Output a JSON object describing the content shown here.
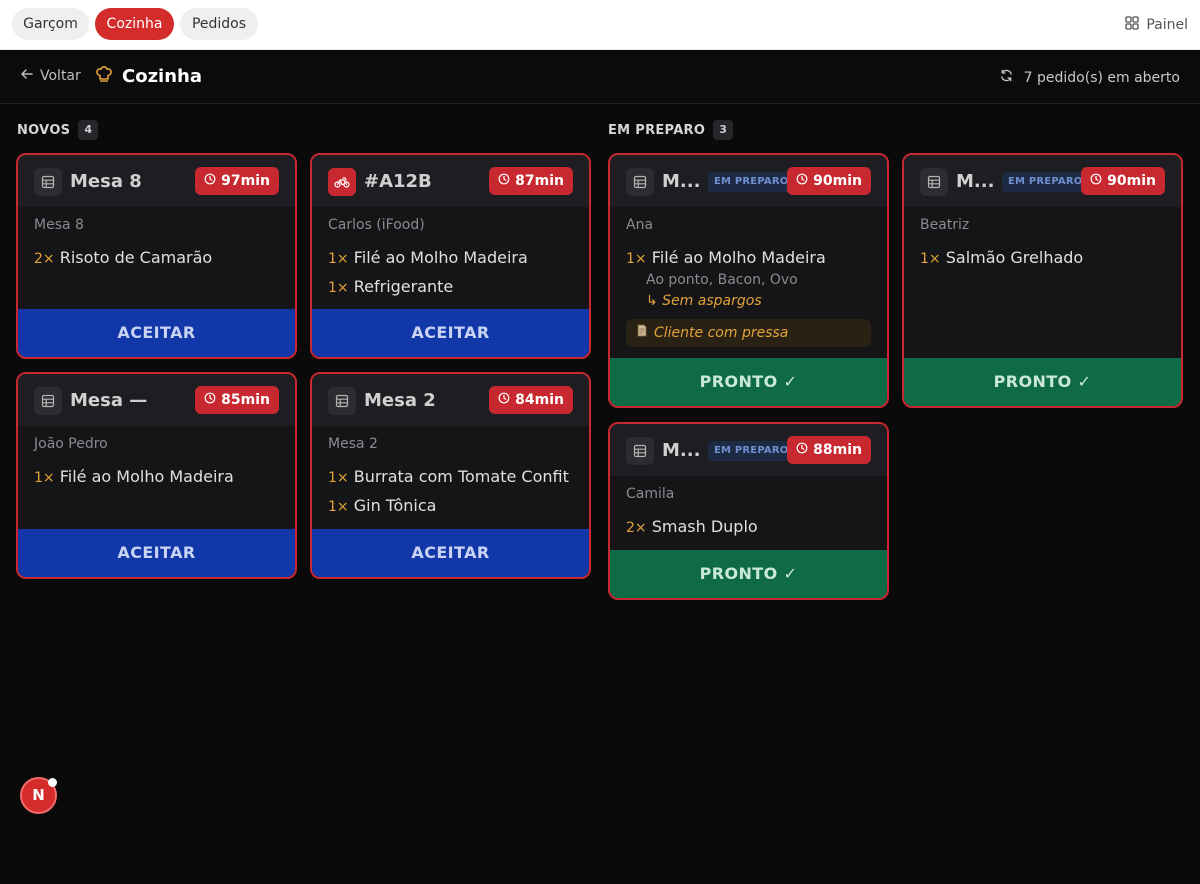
{
  "nav": {
    "tabs": [
      {
        "label": "Garçom"
      },
      {
        "label": "Cozinha"
      },
      {
        "label": "Pedidos"
      }
    ],
    "panel_label": "Painel"
  },
  "header": {
    "back_label": "Voltar",
    "title": "Cozinha",
    "open_count": "7 pedido(s) em aberto"
  },
  "columns": {
    "novos": {
      "title": "NOVOS",
      "count": "4"
    },
    "preparo": {
      "title": "EM PREPARO",
      "count": "3"
    }
  },
  "labels": {
    "accept": "ACEITAR",
    "ready": "PRONTO ✓",
    "in_prep": "EM PREPARO"
  },
  "new_orders": [
    {
      "name": "Mesa 8",
      "icon": "table-icon",
      "timer": "97min",
      "customer": "Mesa 8",
      "items": [
        {
          "qty": "2×",
          "name": "Risoto de Camarão"
        }
      ]
    },
    {
      "name": "#A12B",
      "icon": "bike-icon",
      "timer": "87min",
      "customer": "Carlos (iFood)",
      "items": [
        {
          "qty": "1×",
          "name": "Filé ao Molho Madeira"
        },
        {
          "qty": "1×",
          "name": "Refrigerante"
        }
      ]
    },
    {
      "name": "Mesa —",
      "icon": "table-icon",
      "timer": "85min",
      "customer": "João Pedro",
      "items": [
        {
          "qty": "1×",
          "name": "Filé ao Molho Madeira"
        }
      ]
    },
    {
      "name": "Mesa 2",
      "icon": "table-icon",
      "timer": "84min",
      "customer": "Mesa 2",
      "items": [
        {
          "qty": "1×",
          "name": "Burrata com Tomate Confit"
        },
        {
          "qty": "1×",
          "name": "Gin Tônica"
        }
      ]
    }
  ],
  "prep_orders": [
    {
      "name": "M...",
      "icon": "table-icon",
      "timer": "90min",
      "customer": "Ana",
      "items": [
        {
          "qty": "1×",
          "name": "Filé ao Molho Madeira",
          "mods": "Ao ponto, Bacon, Ovo",
          "without": "↳ Sem aspargos"
        }
      ],
      "note": "Cliente com pressa"
    },
    {
      "name": "M...",
      "icon": "table-icon",
      "timer": "90min",
      "customer": "Beatriz",
      "items": [
        {
          "qty": "1×",
          "name": "Salmão Grelhado"
        }
      ]
    },
    {
      "name": "M...",
      "icon": "table-icon",
      "timer": "88min",
      "customer": "Camila",
      "items": [
        {
          "qty": "2×",
          "name": "Smash Duplo"
        }
      ]
    }
  ],
  "fab_label": "N",
  "colors": {
    "brand_red": "#d42b2b",
    "accept_blue": "#1237a8",
    "ready_green": "#0f6b45",
    "qty_amber": "#e2a23a"
  }
}
